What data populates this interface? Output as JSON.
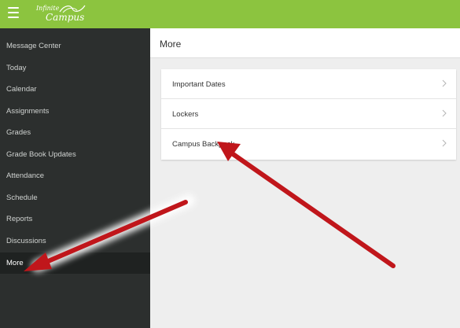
{
  "header": {
    "menu_icon": "hamburger-icon",
    "logo_line1": "Infinite",
    "logo_line2": "Campus",
    "brand_color": "#8cc43f"
  },
  "sidebar": {
    "items": [
      {
        "label": "Message Center"
      },
      {
        "label": "Today"
      },
      {
        "label": "Calendar"
      },
      {
        "label": "Assignments"
      },
      {
        "label": "Grades"
      },
      {
        "label": "Grade Book Updates"
      },
      {
        "label": "Attendance"
      },
      {
        "label": "Schedule"
      },
      {
        "label": "Reports"
      },
      {
        "label": "Discussions"
      },
      {
        "label": "More",
        "active": true
      }
    ]
  },
  "main": {
    "title": "More",
    "rows": [
      {
        "label": "Important Dates",
        "icon": "chevron-right-icon"
      },
      {
        "label": "Lockers",
        "icon": "chevron-right-icon"
      },
      {
        "label": "Campus Backpack",
        "icon": "chevron-right-icon"
      }
    ]
  },
  "annotations": {
    "arrow_color": "#c0161b"
  }
}
